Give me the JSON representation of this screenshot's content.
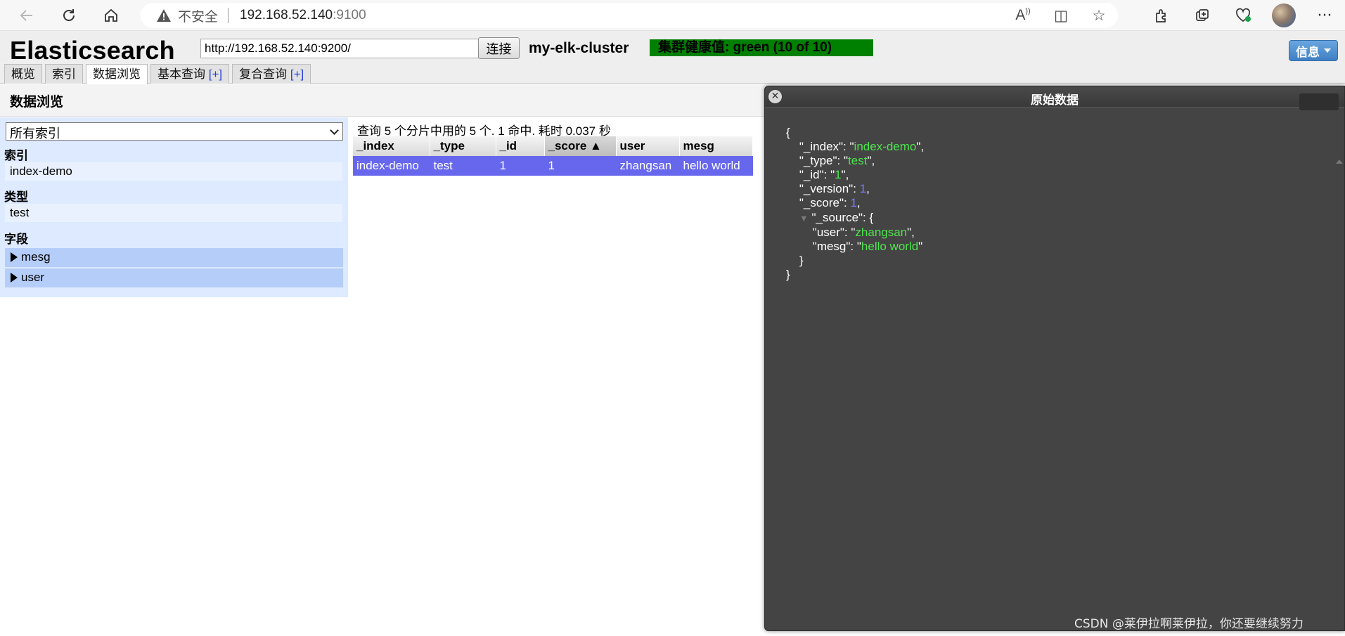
{
  "browser": {
    "insecure_label": "不安全",
    "url_host": "192.168.52.140",
    "url_port": ":9100"
  },
  "header": {
    "title": "Elasticsearch",
    "connect_url": "http://192.168.52.140:9200/",
    "connect_label": "连接",
    "cluster_name": "my-elk-cluster",
    "health": "集群健康值: green (10 of 10)",
    "health_color": "#008000",
    "info_label": "信息"
  },
  "tabs": [
    {
      "label": "概览"
    },
    {
      "label": "索引"
    },
    {
      "label": "数据浏览",
      "active": true
    },
    {
      "label": "基本查询",
      "plus": "[+]"
    },
    {
      "label": "复合查询",
      "plus": "[+]"
    }
  ],
  "browse": {
    "section_title": "数据浏览",
    "index_select": "所有索引",
    "indices_heading": "索引",
    "index_item": "index-demo",
    "types_heading": "类型",
    "type_item": "test",
    "fields_heading": "字段",
    "fields": [
      "mesg",
      "user"
    ]
  },
  "results": {
    "summary": "查询 5 个分片中用的 5 个. 1 命中. 耗时 0.037 秒",
    "columns": [
      "_index",
      "_type",
      "_id",
      "_score ▲",
      "user",
      "mesg"
    ],
    "rows": [
      [
        "index-demo",
        "test",
        "1",
        "1",
        "zhangsan",
        "hello world"
      ]
    ],
    "selected_row_color": "#6767ee"
  },
  "dialog": {
    "title": "原始数据",
    "close_glyph": "✕",
    "doc": {
      "_index": "index-demo",
      "_type": "test",
      "_id": "1",
      "_version": 1,
      "_score": 1,
      "_source": {
        "user": "zhangsan",
        "mesg": "hello world"
      }
    }
  },
  "watermark": "CSDN @莱伊拉啊莱伊拉，你还要继续努力"
}
